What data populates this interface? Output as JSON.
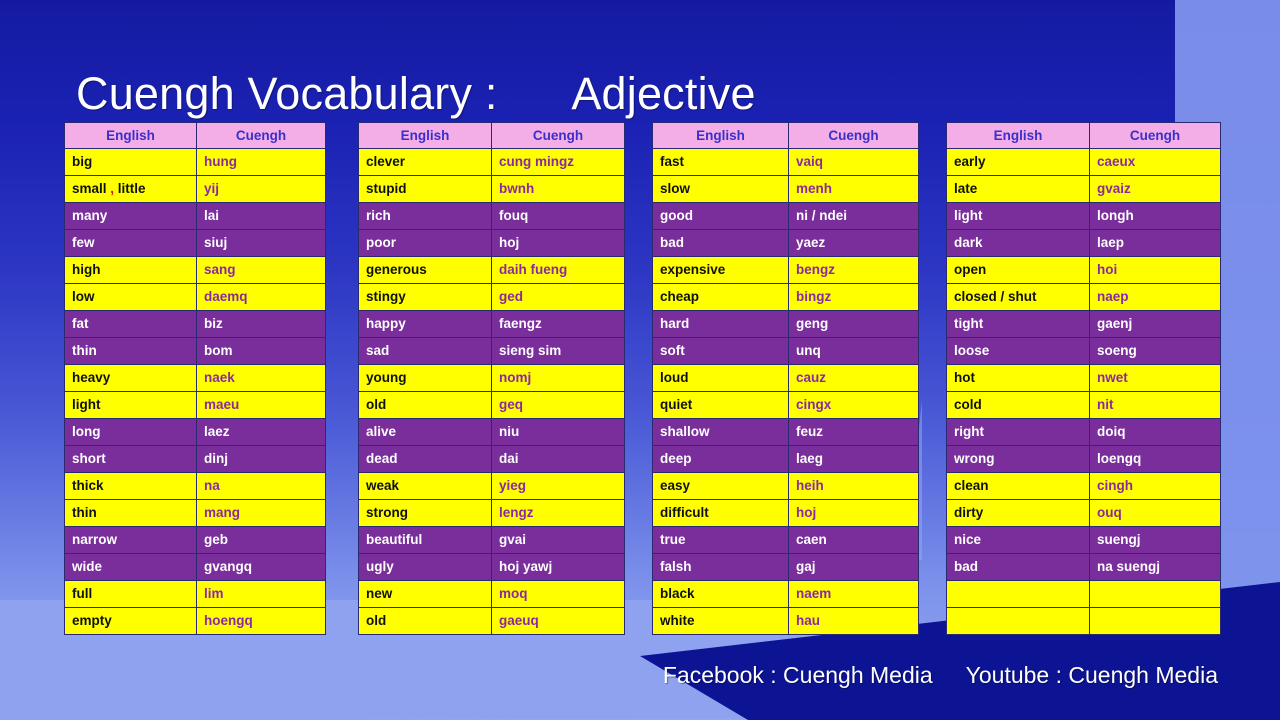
{
  "title": "Cuengh Vocabulary :      Adjective",
  "colors": {
    "background_top": "#141AA0",
    "background_bottom": "#93A6F2",
    "header_fill": "#F3AEE8",
    "header_text": "#3B2FC9",
    "row_yellow": "#FFFF00",
    "row_purple": "#7A2E9B",
    "yellow_english_text": "#101010",
    "yellow_cuengh_text": "#8B2A9E",
    "purple_text": "#FFFFFF",
    "title_text": "#FFFFFF",
    "accent_red": "#D81616"
  },
  "column_headers": [
    "English",
    "Cuengh"
  ],
  "tables": [
    {
      "headers": [
        "English",
        "Cuengh"
      ],
      "rows": [
        {
          "english": "big",
          "cuengh": "hung",
          "style": "yellow"
        },
        {
          "english": "small , little",
          "cuengh": "yij",
          "style": "yellow"
        },
        {
          "english": "many",
          "cuengh": "lai",
          "style": "purple"
        },
        {
          "english": "few",
          "cuengh": "siuj",
          "style": "purple"
        },
        {
          "english": "high",
          "cuengh": "sang",
          "style": "yellow"
        },
        {
          "english": "low",
          "cuengh": "daemq",
          "style": "yellow"
        },
        {
          "english": "fat",
          "cuengh": "biz",
          "style": "purple"
        },
        {
          "english": "thin",
          "cuengh": "bom",
          "style": "purple"
        },
        {
          "english": "heavy",
          "cuengh": "naek",
          "style": "yellow"
        },
        {
          "english": "light",
          "cuengh": "maeu",
          "style": "yellow"
        },
        {
          "english": "long",
          "cuengh": "laez",
          "style": "purple"
        },
        {
          "english": "short",
          "cuengh": "dinj",
          "style": "purple"
        },
        {
          "english": "thick",
          "cuengh": "na",
          "style": "yellow"
        },
        {
          "english": "thin",
          "cuengh": "mang",
          "style": "yellow"
        },
        {
          "english": "narrow",
          "cuengh": "geb",
          "style": "purple"
        },
        {
          "english": "wide",
          "cuengh": "gvangq",
          "style": "purple"
        },
        {
          "english": "full",
          "cuengh": "lim",
          "style": "yellow"
        },
        {
          "english": "empty",
          "cuengh": "hoengq",
          "style": "yellow"
        }
      ]
    },
    {
      "headers": [
        "English",
        "Cuengh"
      ],
      "rows": [
        {
          "english": "clever",
          "cuengh": "cung mingz",
          "style": "yellow"
        },
        {
          "english": "stupid",
          "cuengh": "bwnh",
          "style": "yellow"
        },
        {
          "english": "rich",
          "cuengh": "fouq",
          "style": "purple"
        },
        {
          "english": "poor",
          "cuengh": "hoj",
          "style": "purple"
        },
        {
          "english": "generous",
          "cuengh": "daih fueng",
          "style": "yellow"
        },
        {
          "english": "stingy",
          "cuengh": "ged",
          "style": "yellow"
        },
        {
          "english": "happy",
          "cuengh": "faengz",
          "style": "purple"
        },
        {
          "english": "sad",
          "cuengh": "sieng sim",
          "style": "purple"
        },
        {
          "english": "young",
          "cuengh": "nomj",
          "style": "yellow"
        },
        {
          "english": "old",
          "cuengh": "geq",
          "style": "yellow"
        },
        {
          "english": "alive",
          "cuengh": "niu",
          "style": "purple"
        },
        {
          "english": "dead",
          "cuengh": "dai",
          "style": "purple"
        },
        {
          "english": "weak",
          "cuengh": "yieg",
          "style": "yellow"
        },
        {
          "english": "strong",
          "cuengh": "lengz",
          "style": "yellow"
        },
        {
          "english": "beautiful",
          "cuengh": "gvai",
          "style": "purple"
        },
        {
          "english": "ugly",
          "cuengh": "hoj yawj",
          "style": "purple"
        },
        {
          "english": "new",
          "cuengh": "moq",
          "style": "yellow"
        },
        {
          "english": "old",
          "cuengh": "gaeuq",
          "style": "yellow"
        }
      ]
    },
    {
      "headers": [
        "English",
        "Cuengh"
      ],
      "rows": [
        {
          "english": "fast",
          "cuengh": "vaiq",
          "style": "yellow"
        },
        {
          "english": "slow",
          "cuengh": "menh",
          "style": "yellow"
        },
        {
          "english": "good",
          "cuengh": "ni / ndei",
          "style": "purple"
        },
        {
          "english": "bad",
          "cuengh": "yaez",
          "style": "purple"
        },
        {
          "english": "expensive",
          "cuengh": "bengz",
          "style": "yellow"
        },
        {
          "english": "cheap",
          "cuengh": "bingz",
          "style": "yellow"
        },
        {
          "english": "hard",
          "cuengh": "geng",
          "style": "purple"
        },
        {
          "english": "soft",
          "cuengh": "unq",
          "style": "purple"
        },
        {
          "english": "loud",
          "cuengh": "cauz",
          "style": "yellow"
        },
        {
          "english": "quiet",
          "cuengh": "cingx",
          "style": "yellow"
        },
        {
          "english": "shallow",
          "cuengh": "feuz",
          "style": "purple"
        },
        {
          "english": "deep",
          "cuengh": "laeg",
          "style": "purple"
        },
        {
          "english": "easy",
          "cuengh": "heih",
          "style": "yellow"
        },
        {
          "english": "difficult",
          "cuengh": "hoj",
          "style": "yellow"
        },
        {
          "english": "true",
          "cuengh": "caen",
          "style": "purple"
        },
        {
          "english": "falsh",
          "cuengh": "gaj",
          "style": "purple"
        },
        {
          "english": "black",
          "cuengh": "naem",
          "style": "yellow"
        },
        {
          "english": "white",
          "cuengh": "hau",
          "style": "yellow"
        }
      ]
    },
    {
      "headers": [
        "English",
        "Cuengh"
      ],
      "rows": [
        {
          "english": "early",
          "cuengh": "caeux",
          "style": "yellow"
        },
        {
          "english": "late",
          "cuengh": "gvaiz",
          "style": "yellow"
        },
        {
          "english": "light",
          "cuengh": "longh",
          "style": "purple"
        },
        {
          "english": "dark",
          "cuengh": "laep",
          "style": "purple"
        },
        {
          "english": "open",
          "cuengh": "hoi",
          "style": "yellow"
        },
        {
          "english": "closed / shut",
          "cuengh": "naep",
          "style": "yellow"
        },
        {
          "english": "tight",
          "cuengh": "gaenj",
          "style": "purple"
        },
        {
          "english": "loose",
          "cuengh": "soeng",
          "style": "purple"
        },
        {
          "english": "hot",
          "cuengh": "nwet",
          "style": "yellow"
        },
        {
          "english": "cold",
          "cuengh": "nit",
          "style": "yellow"
        },
        {
          "english": "right",
          "cuengh": "doiq",
          "style": "purple"
        },
        {
          "english": "wrong",
          "cuengh": "loengq",
          "style": "purple"
        },
        {
          "english": "clean",
          "cuengh": "cingh",
          "style": "yellow"
        },
        {
          "english": "dirty",
          "cuengh": "ouq",
          "style": "yellow"
        },
        {
          "english": "nice",
          "cuengh": "suengj",
          "style": "purple"
        },
        {
          "english": "bad",
          "cuengh": "na suengj",
          "style": "purple"
        },
        {
          "english": "",
          "cuengh": "",
          "style": "empty"
        },
        {
          "english": "",
          "cuengh": "",
          "style": "empty"
        }
      ]
    }
  ],
  "footer": {
    "facebook": "Facebook : Cuengh Media",
    "youtube": "Youtube : Cuengh Media"
  }
}
